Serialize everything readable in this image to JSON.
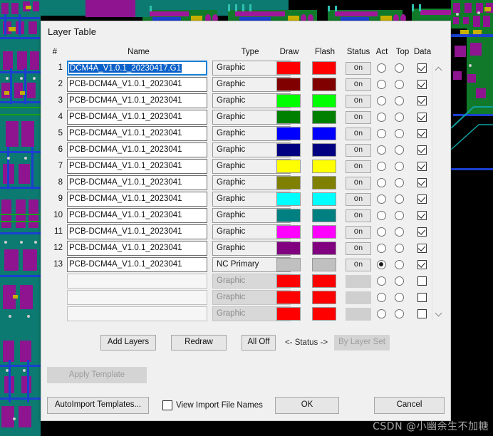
{
  "window": {
    "title": "Layer Table"
  },
  "table": {
    "headers": [
      "#",
      "Name",
      "Type",
      "Draw",
      "Flash",
      "Status",
      "Act",
      "Top",
      "Data"
    ],
    "rows": [
      {
        "index": "1",
        "name": "DCM4A_V1.0.1_20230417.G1",
        "name_selected": true,
        "type": "Graphic",
        "draw": "#FF0000",
        "flash": "#FF0000",
        "status": "On",
        "act": false,
        "top": false,
        "data": true,
        "enabled": true
      },
      {
        "index": "2",
        "name": "PCB-DCM4A_V1.0.1_2023041",
        "name_selected": false,
        "type": "Graphic",
        "draw": "#800000",
        "flash": "#800000",
        "status": "On",
        "act": false,
        "top": false,
        "data": true,
        "enabled": true
      },
      {
        "index": "3",
        "name": "PCB-DCM4A_V1.0.1_2023041",
        "name_selected": false,
        "type": "Graphic",
        "draw": "#00FF00",
        "flash": "#00FF00",
        "status": "On",
        "act": false,
        "top": false,
        "data": true,
        "enabled": true
      },
      {
        "index": "4",
        "name": "PCB-DCM4A_V1.0.1_2023041",
        "name_selected": false,
        "type": "Graphic",
        "draw": "#008000",
        "flash": "#008000",
        "status": "On",
        "act": false,
        "top": false,
        "data": true,
        "enabled": true
      },
      {
        "index": "5",
        "name": "PCB-DCM4A_V1.0.1_2023041",
        "name_selected": false,
        "type": "Graphic",
        "draw": "#0000FF",
        "flash": "#0000FF",
        "status": "On",
        "act": false,
        "top": false,
        "data": true,
        "enabled": true
      },
      {
        "index": "6",
        "name": "PCB-DCM4A_V1.0.1_2023041",
        "name_selected": false,
        "type": "Graphic",
        "draw": "#000080",
        "flash": "#000080",
        "status": "On",
        "act": false,
        "top": false,
        "data": true,
        "enabled": true
      },
      {
        "index": "7",
        "name": "PCB-DCM4A_V1.0.1_2023041",
        "name_selected": false,
        "type": "Graphic",
        "draw": "#FFFF00",
        "flash": "#FFFF00",
        "status": "On",
        "act": false,
        "top": false,
        "data": true,
        "enabled": true
      },
      {
        "index": "8",
        "name": "PCB-DCM4A_V1.0.1_2023041",
        "name_selected": false,
        "type": "Graphic",
        "draw": "#808000",
        "flash": "#808000",
        "status": "On",
        "act": false,
        "top": false,
        "data": true,
        "enabled": true
      },
      {
        "index": "9",
        "name": "PCB-DCM4A_V1.0.1_2023041",
        "name_selected": false,
        "type": "Graphic",
        "draw": "#00FFFF",
        "flash": "#00FFFF",
        "status": "On",
        "act": false,
        "top": false,
        "data": true,
        "enabled": true
      },
      {
        "index": "10",
        "name": "PCB-DCM4A_V1.0.1_2023041",
        "name_selected": false,
        "type": "Graphic",
        "draw": "#008080",
        "flash": "#008080",
        "status": "On",
        "act": false,
        "top": false,
        "data": true,
        "enabled": true
      },
      {
        "index": "11",
        "name": "PCB-DCM4A_V1.0.1_2023041",
        "name_selected": false,
        "type": "Graphic",
        "draw": "#FF00FF",
        "flash": "#FF00FF",
        "status": "On",
        "act": false,
        "top": false,
        "data": true,
        "enabled": true
      },
      {
        "index": "12",
        "name": "PCB-DCM4A_V1.0.1_2023041",
        "name_selected": false,
        "type": "Graphic",
        "draw": "#800080",
        "flash": "#800080",
        "status": "On",
        "act": false,
        "top": false,
        "data": true,
        "enabled": true
      },
      {
        "index": "13",
        "name": "PCB-DCM4A_V1.0.1_2023041",
        "name_selected": false,
        "type": "NC Primary",
        "draw": "#C0C0C0",
        "flash": "#C0C0C0",
        "status": "On",
        "act": true,
        "top": false,
        "data": true,
        "enabled": true
      },
      {
        "index": "",
        "name": "",
        "name_selected": false,
        "type": "Graphic",
        "draw": "#FF0000",
        "flash": "#FF0000",
        "status": "",
        "act": false,
        "top": false,
        "data": false,
        "enabled": false
      },
      {
        "index": "",
        "name": "",
        "name_selected": false,
        "type": "Graphic",
        "draw": "#FF0000",
        "flash": "#FF0000",
        "status": "",
        "act": false,
        "top": false,
        "data": false,
        "enabled": false
      },
      {
        "index": "",
        "name": "",
        "name_selected": false,
        "type": "Graphic",
        "draw": "#FF0000",
        "flash": "#FF0000",
        "status": "",
        "act": false,
        "top": false,
        "data": false,
        "enabled": false
      }
    ]
  },
  "scrollbar": {
    "up_icon": "chevron-up-icon",
    "down_icon": "chevron-down-icon"
  },
  "actions": {
    "add_layers": "Add Layers",
    "redraw": "Redraw",
    "all_off": "All Off",
    "status_nav": "<- Status ->",
    "by_layer_set": "By Layer Set",
    "apply_template": "Apply Template",
    "auto_import": "AutoImport Templates...",
    "view_import_file_names": "View Import File Names",
    "ok": "OK",
    "cancel": "Cancel"
  },
  "watermark": {
    "text": "CSDN @小幽余生不加糖"
  },
  "colors": {
    "dialog_bg": "#f0f0f0",
    "selection_blue": "#0a60c8",
    "focus_border": "#1a7fd4",
    "pcb_board": "#0c7a70",
    "pcb_black": "#000000"
  }
}
